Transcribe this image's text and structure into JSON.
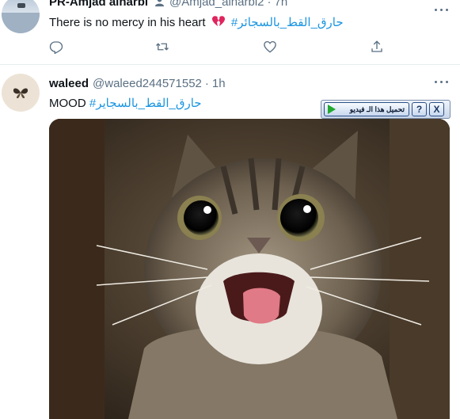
{
  "tweet1": {
    "name": "PR-Amjad alharbi",
    "handle": "@Amjad_alharbi2",
    "separator": "·",
    "time": "7h",
    "text": "There is no mercy in his heart",
    "hashtag": "#حارق_القط_بالسجائر",
    "actions": [
      "reply-icon",
      "retweet-icon",
      "like-icon",
      "share-icon"
    ]
  },
  "tweet2": {
    "name": "waleed",
    "handle": "@waleed244571552",
    "separator": "·",
    "time": "1h",
    "text": "MOOD",
    "hashtag": "#حارق_القط_بالسجاير"
  },
  "download_toolbar": {
    "button_label": "تحميل هذا الـ فيديو",
    "help_label": "?",
    "close_label": "X"
  },
  "colors": {
    "accent": "#1b95e0",
    "secondary_text": "#5b7083",
    "divider": "#e6ecf0",
    "broken_heart": "#e0245e"
  }
}
